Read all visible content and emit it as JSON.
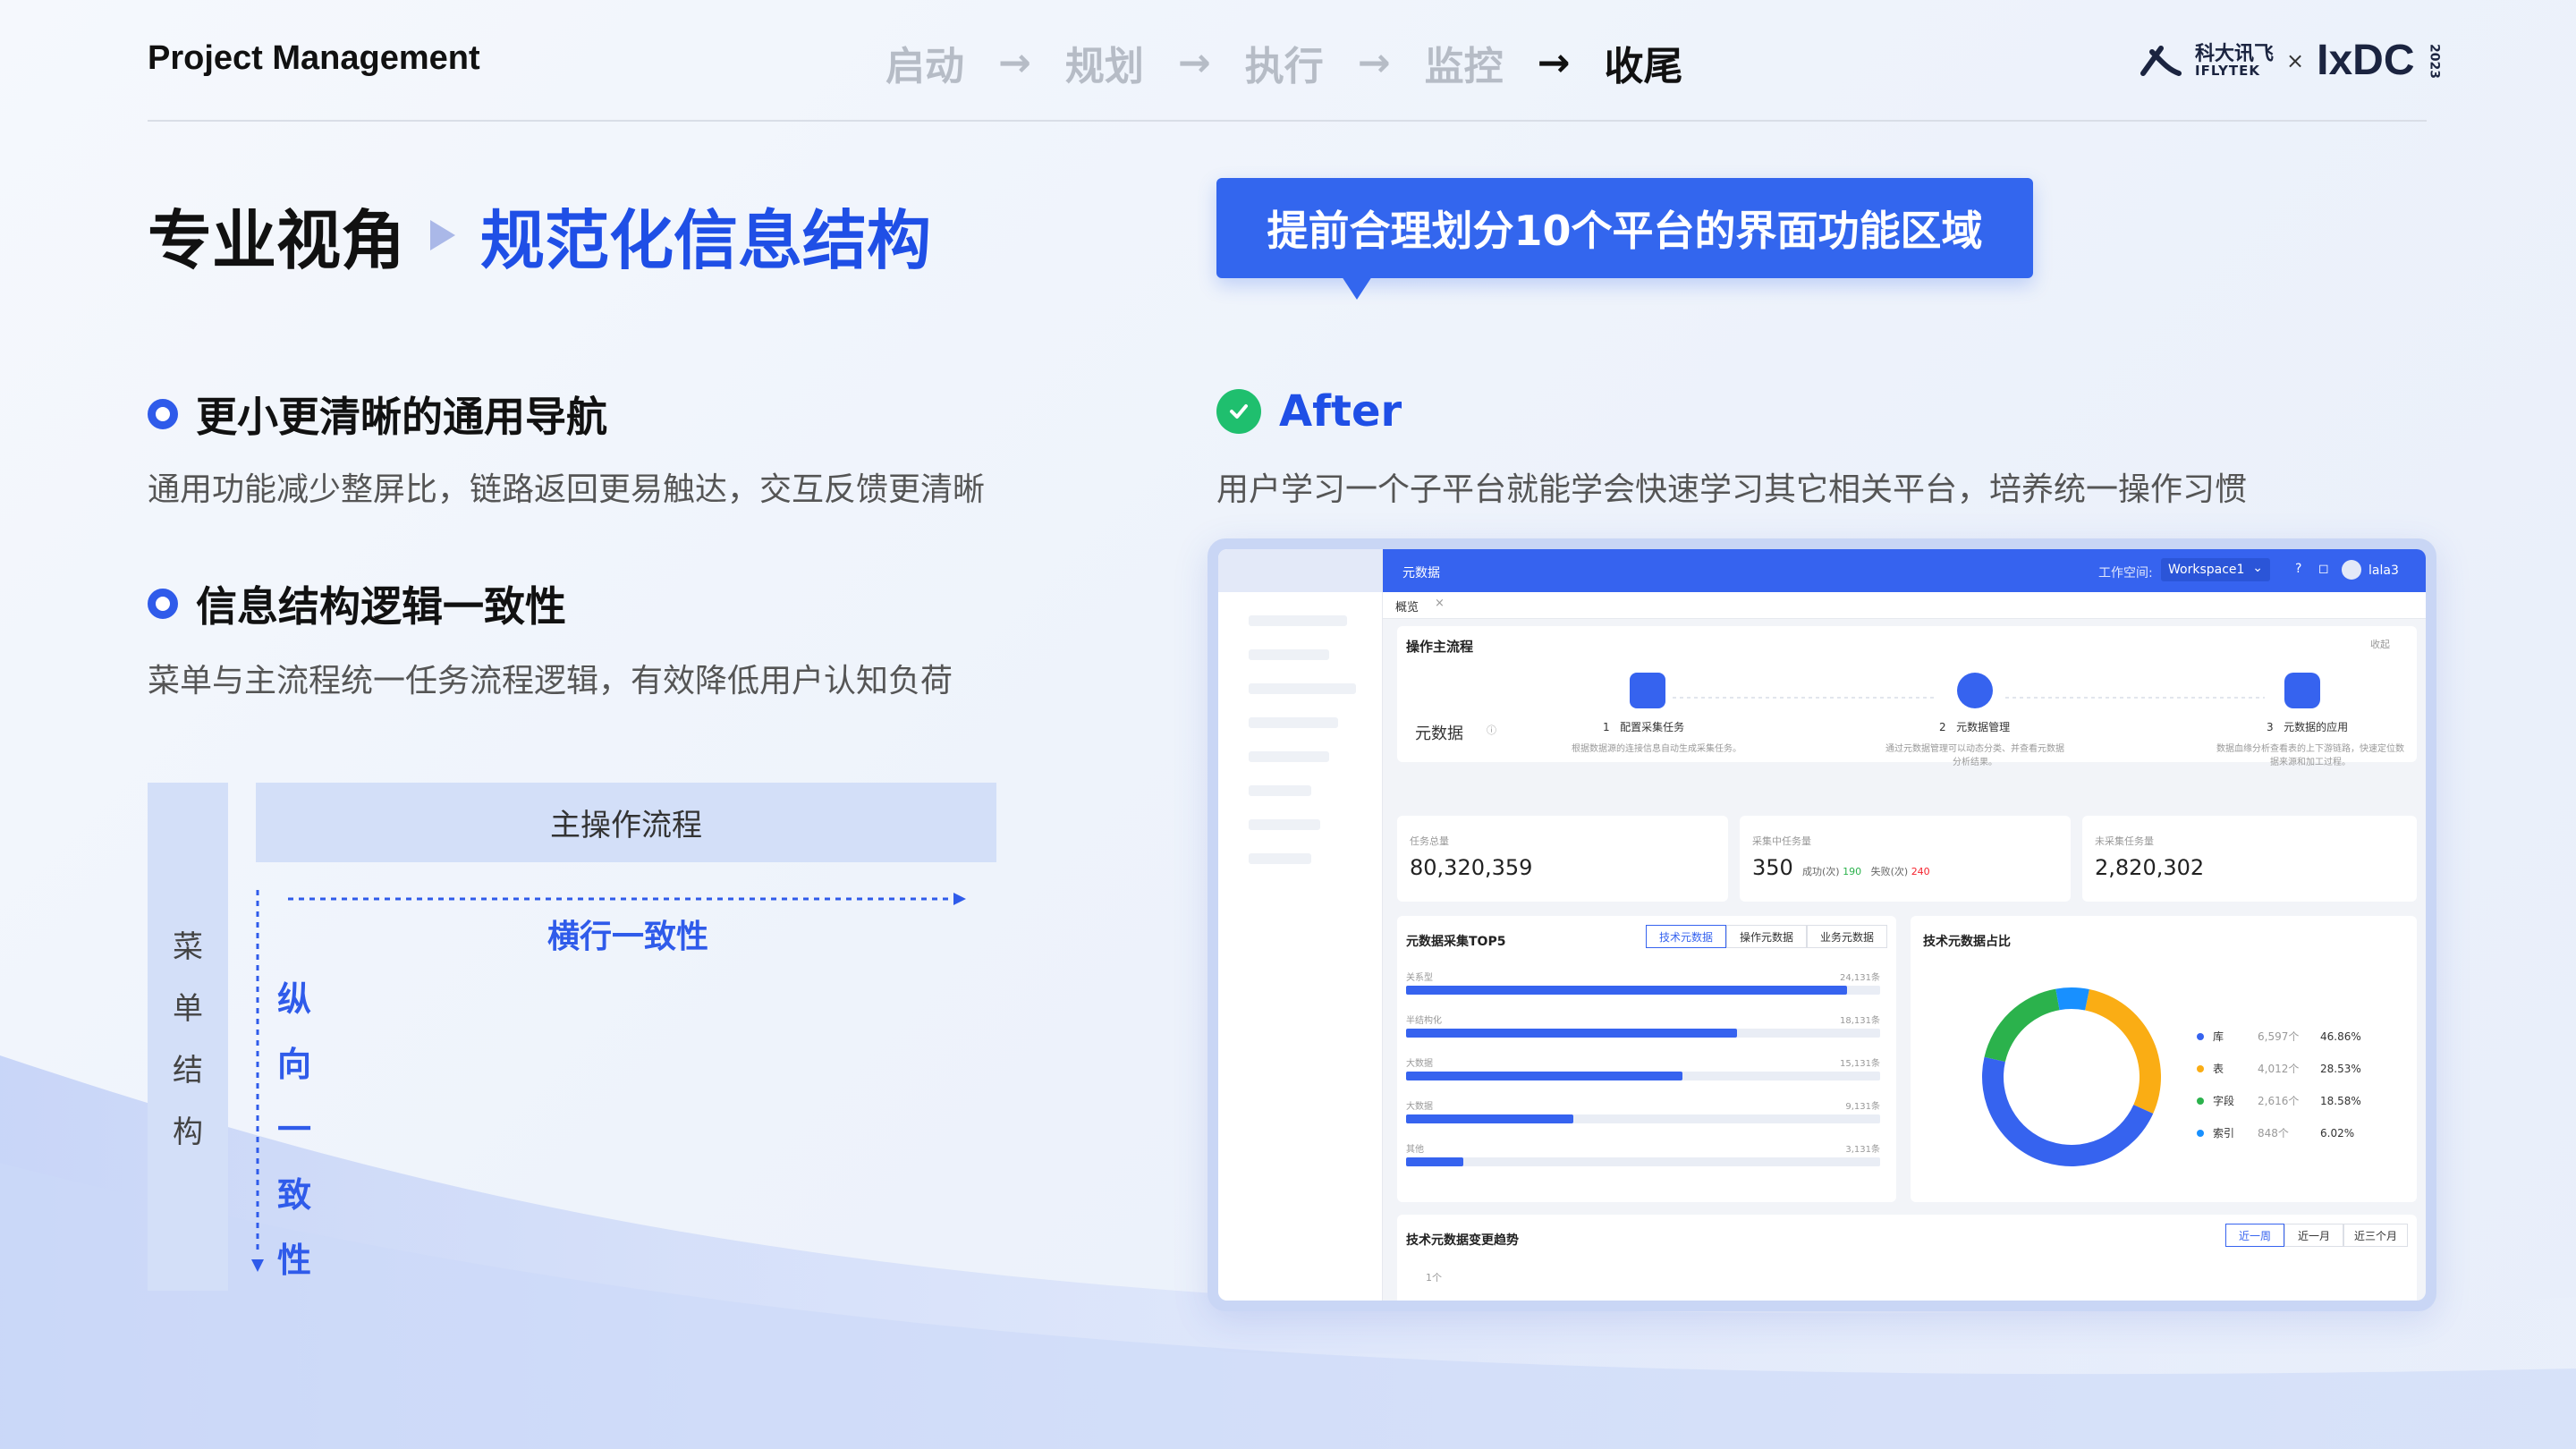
{
  "header": {
    "title": "Project Management",
    "steps": [
      "启动",
      "规划",
      "执行",
      "监控",
      "收尾"
    ],
    "active_step": 4,
    "arrow_glyph": "→",
    "logo": {
      "cn": "科大讯飞",
      "en": "IFLYTEK",
      "times": "×",
      "brand": "IxDC",
      "year": "2023"
    }
  },
  "title": {
    "part1": "专业视角",
    "part2": "规范化信息结构"
  },
  "callout": "提前合理划分10个平台的界面功能区域",
  "left": {
    "sec1": {
      "heading": "更小更清晰的通用导航",
      "desc": "通用功能减少整屏比，链路返回更易触达，交互反馈更清晰"
    },
    "sec2": {
      "heading": "信息结构逻辑一致性",
      "desc": "菜单与主流程统一任务流程逻辑，有效降低用户认知负荷"
    }
  },
  "diagram": {
    "menu_chars": [
      "菜",
      "单",
      "结",
      "构"
    ],
    "main_flow": "主操作流程",
    "horizontal": "横行一致性",
    "vertical_chars": [
      "纵",
      "向",
      "一",
      "致",
      "性"
    ]
  },
  "right": {
    "after_heading": "After",
    "after_desc": "用户学习一个子平台就能学会快速学习其它相关平台，培养统一操作习惯"
  },
  "app": {
    "topbar_title": "元数据",
    "workspace_label": "工作空间:",
    "workspace_value": "Workspace1",
    "user": "lala3",
    "tab": "概览",
    "flow": {
      "title": "操作主流程",
      "collapse": "收起",
      "left_label": "元数据",
      "steps": [
        {
          "n": "1",
          "title": "配置采集任务",
          "desc": "根据数据源的连接信息自动生成采集任务。"
        },
        {
          "n": "2",
          "title": "元数据管理",
          "desc": "通过元数据管理可以动态分类、并查看元数据分析结果。"
        },
        {
          "n": "3",
          "title": "元数据的应用",
          "desc": "数据血缘分析查看表的上下游链路，快速定位数据来源和加工过程。"
        }
      ]
    },
    "stats": [
      {
        "label": "任务总量",
        "value": "80,320,359"
      },
      {
        "label": "采集中任务量",
        "value": "350",
        "ok_label": "成功(次)",
        "ok": "190",
        "fail_label": "失败(次)",
        "fail": "240"
      },
      {
        "label": "未采集任务量",
        "value": "2,820,302"
      }
    ],
    "top5": {
      "title": "元数据采集TOP5",
      "tabs": [
        "技术元数据",
        "操作元数据",
        "业务元数据"
      ],
      "rows": [
        {
          "label": "关系型",
          "value_text": "24,131条",
          "value": 24131
        },
        {
          "label": "半结构化",
          "value_text": "18,131条",
          "value": 18131
        },
        {
          "label": "大数据",
          "value_text": "15,131条",
          "value": 15131
        },
        {
          "label": "大数据",
          "value_text": "9,131条",
          "value": 9131
        },
        {
          "label": "其他",
          "value_text": "3,131条",
          "value": 3131
        }
      ]
    },
    "share": {
      "title": "技术元数据占比",
      "items": [
        {
          "name": "库",
          "count": "6,597个",
          "pct": "46.86%",
          "value": 46.86,
          "color": "#3663ef"
        },
        {
          "name": "表",
          "count": "4,012个",
          "pct": "28.53%",
          "value": 28.53,
          "color": "#faad14"
        },
        {
          "name": "字段",
          "count": "2,616个",
          "pct": "18.58%",
          "value": 18.58,
          "color": "#2bb24c"
        },
        {
          "name": "索引",
          "count": "848个",
          "pct": "6.02%",
          "value": 6.02,
          "color": "#1890ff"
        }
      ]
    },
    "trend": {
      "title": "技术元数据变更趋势",
      "tabs": [
        "近一周",
        "近一月",
        "近三个月"
      ],
      "y_tick": "1个"
    }
  }
}
